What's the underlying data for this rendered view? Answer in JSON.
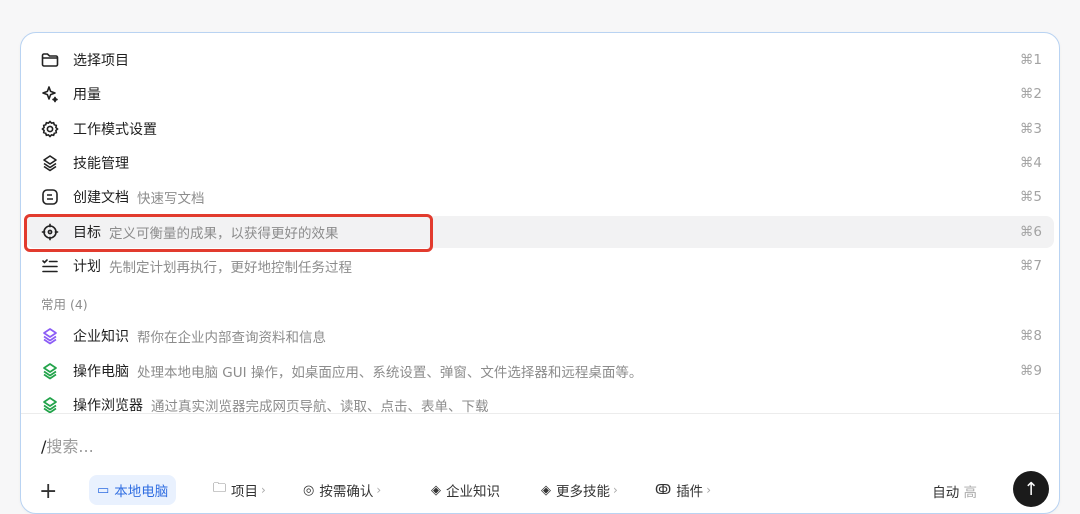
{
  "menu": {
    "items": [
      {
        "icon": "folder-icon",
        "label": "选择项目",
        "desc": "",
        "shortcut": "⌘1"
      },
      {
        "icon": "sparkle-icon",
        "label": "用量",
        "desc": "",
        "shortcut": "⌘2"
      },
      {
        "icon": "gear-icon",
        "label": "工作模式设置",
        "desc": "",
        "shortcut": "⌘3"
      },
      {
        "icon": "layers-icon",
        "label": "技能管理",
        "desc": "",
        "shortcut": "⌘4"
      },
      {
        "icon": "document-icon",
        "label": "创建文档",
        "desc": "快速写文档",
        "shortcut": "⌘5"
      },
      {
        "icon": "target-icon",
        "label": "目标",
        "desc": "定义可衡量的成果，以获得更好的效果",
        "shortcut": "⌘6"
      },
      {
        "icon": "checklist-icon",
        "label": "计划",
        "desc": "先制定计划再执行，更好地控制任务过程",
        "shortcut": "⌘7"
      }
    ],
    "section_label": "常用 (4)",
    "common_items": [
      {
        "icon": "purple-layers-icon",
        "label": "企业知识",
        "desc": "帮你在企业内部查询资料和信息",
        "shortcut": "⌘8"
      },
      {
        "icon": "green-layers-icon",
        "label": "操作电脑",
        "desc": "处理本地电脑 GUI 操作，如桌面应用、系统设置、弹窗、文件选择器和远程桌面等。",
        "shortcut": "⌘9"
      },
      {
        "icon": "green-layers-icon",
        "label": "操作浏览器",
        "desc": "通过真实浏览器完成网页导航、读取、点击、表单、下载",
        "shortcut": ""
      }
    ]
  },
  "search": {
    "slash": "/",
    "placeholder": "搜索..."
  },
  "toolbar": {
    "plus": "+",
    "local_computer": "本地电脑",
    "project": "项目",
    "confirm": "按需确认",
    "enterprise_knowledge": "企业知识",
    "more_skills": "更多技能",
    "plugins": "插件",
    "auto": "自动",
    "auto_suffix": "高"
  },
  "colors": {
    "accent": "#2f6de1",
    "highlight": "#e23b2e",
    "purple": "#8b5cf6",
    "green": "#22a34a"
  }
}
